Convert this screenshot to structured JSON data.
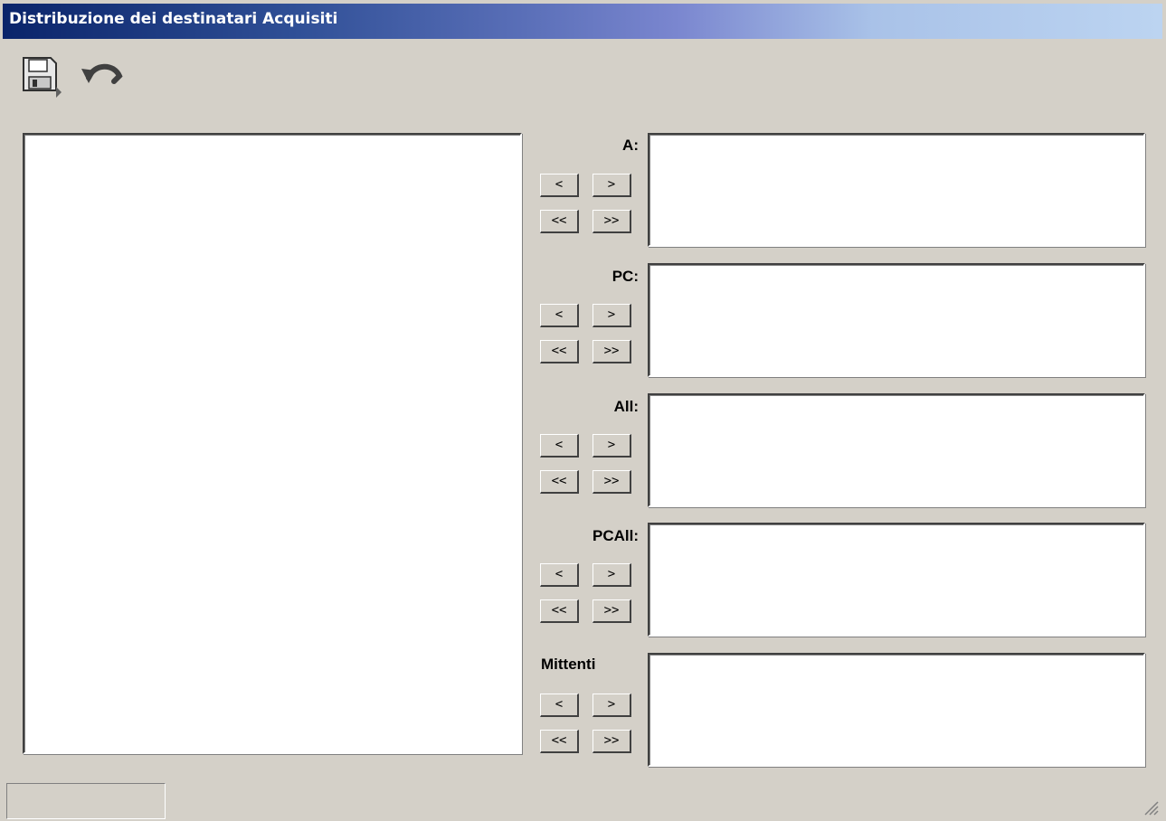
{
  "window": {
    "title": "Distribuzione dei destinatari Acquisiti"
  },
  "toolbar": {
    "icons": [
      "save-icon",
      "undo-icon"
    ]
  },
  "groups": [
    {
      "label": "A:",
      "buttons": [
        "<",
        ">",
        "<<",
        ">>"
      ]
    },
    {
      "label": "PC:",
      "buttons": [
        "<",
        ">",
        "<<",
        ">>"
      ]
    },
    {
      "label": "All:",
      "buttons": [
        "<",
        ">",
        "<<",
        ">>"
      ]
    },
    {
      "label": "PCAll:",
      "buttons": [
        "<",
        ">",
        "<<",
        ">>"
      ]
    },
    {
      "label": "Mittenti",
      "buttons": [
        "<",
        ">",
        "<<",
        ">>"
      ]
    }
  ],
  "status": {
    "text": ""
  }
}
